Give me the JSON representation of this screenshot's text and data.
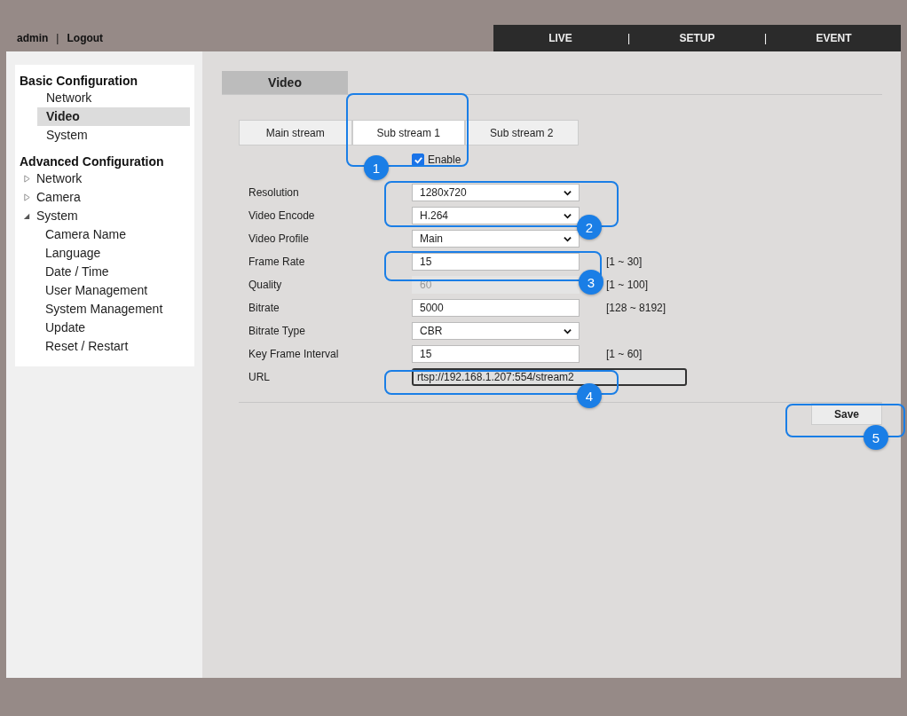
{
  "header": {
    "user": "admin",
    "separator": "|",
    "logout": "Logout"
  },
  "nav": [
    {
      "label": "LIVE"
    },
    {
      "label": "SETUP"
    },
    {
      "label": "EVENT"
    }
  ],
  "nav_separator": "|",
  "sidebar": {
    "sections": [
      {
        "title": "Basic Configuration",
        "items": [
          {
            "label": "Network",
            "selected": false
          },
          {
            "label": "Video",
            "selected": true
          },
          {
            "label": "System",
            "selected": false
          }
        ]
      },
      {
        "title": "Advanced Configuration",
        "items": [
          {
            "label": "Network",
            "kind": "group",
            "expanded": false
          },
          {
            "label": "Camera",
            "kind": "group",
            "expanded": false
          },
          {
            "label": "System",
            "kind": "group",
            "expanded": true,
            "children": [
              {
                "label": "Camera Name"
              },
              {
                "label": "Language"
              },
              {
                "label": "Date / Time"
              },
              {
                "label": "User Management"
              },
              {
                "label": "System Management"
              },
              {
                "label": "Update"
              },
              {
                "label": "Reset / Restart"
              }
            ]
          }
        ]
      }
    ]
  },
  "page_tab": "Video",
  "stream_tabs": [
    {
      "label": "Main stream",
      "selected": false
    },
    {
      "label": "Sub stream 1",
      "selected": true
    },
    {
      "label": "Sub stream 2",
      "selected": false
    }
  ],
  "enable": {
    "label": "Enable",
    "checked": true
  },
  "fields": [
    {
      "label": "Resolution",
      "kind": "select",
      "value": "1280x720"
    },
    {
      "label": "Video Encode",
      "kind": "select",
      "value": "H.264"
    },
    {
      "label": "Video Profile",
      "kind": "select",
      "value": "Main"
    },
    {
      "label": "Frame Rate",
      "kind": "input",
      "value": "15",
      "range": "[1 ~ 30]",
      "disabled": false
    },
    {
      "label": "Quality",
      "kind": "input",
      "value": "60",
      "range": "[1 ~ 100]",
      "disabled": true
    },
    {
      "label": "Bitrate",
      "kind": "input",
      "value": "5000",
      "range": "[128 ~ 8192]",
      "disabled": false
    },
    {
      "label": "Bitrate Type",
      "kind": "select",
      "value": "CBR"
    },
    {
      "label": "Key Frame Interval",
      "kind": "input",
      "value": "15",
      "range": "[1 ~ 60]",
      "disabled": false
    },
    {
      "label": "URL",
      "kind": "url",
      "value": "rtsp://192.168.1.207:554/stream2"
    }
  ],
  "save_button": "Save",
  "callouts": [
    "1",
    "2",
    "3",
    "4",
    "5"
  ]
}
